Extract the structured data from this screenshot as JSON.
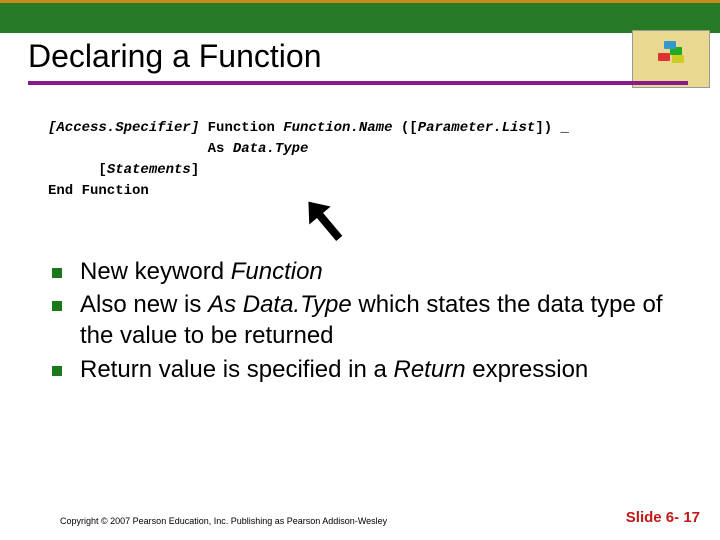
{
  "title": "Declaring a Function",
  "code": {
    "l1a": "[Access.Specifier]",
    "l1b": " Function ",
    "l1c": "Function.Name",
    "l1d": " ([",
    "l1e": "Parameter.List",
    "l1f": "]) _",
    "l2a": "                   As ",
    "l2b": "Data.Type",
    "l3a": "      [",
    "l3b": "Statements",
    "l3c": "]",
    "l4": "End Function"
  },
  "bullets": [
    {
      "pre": "New keyword ",
      "em": "Function",
      "post": ""
    },
    {
      "pre": "Also new is ",
      "em": "As Data.Type",
      "post": " which states the data type of the value to be returned"
    },
    {
      "pre": "Return value is specified in a ",
      "em": "Return",
      "post": " expression"
    }
  ],
  "footer": {
    "copyright": "Copyright © 2007 Pearson Education, Inc. Publishing as Pearson Addison-Wesley",
    "slide": "Slide 6- 17"
  }
}
